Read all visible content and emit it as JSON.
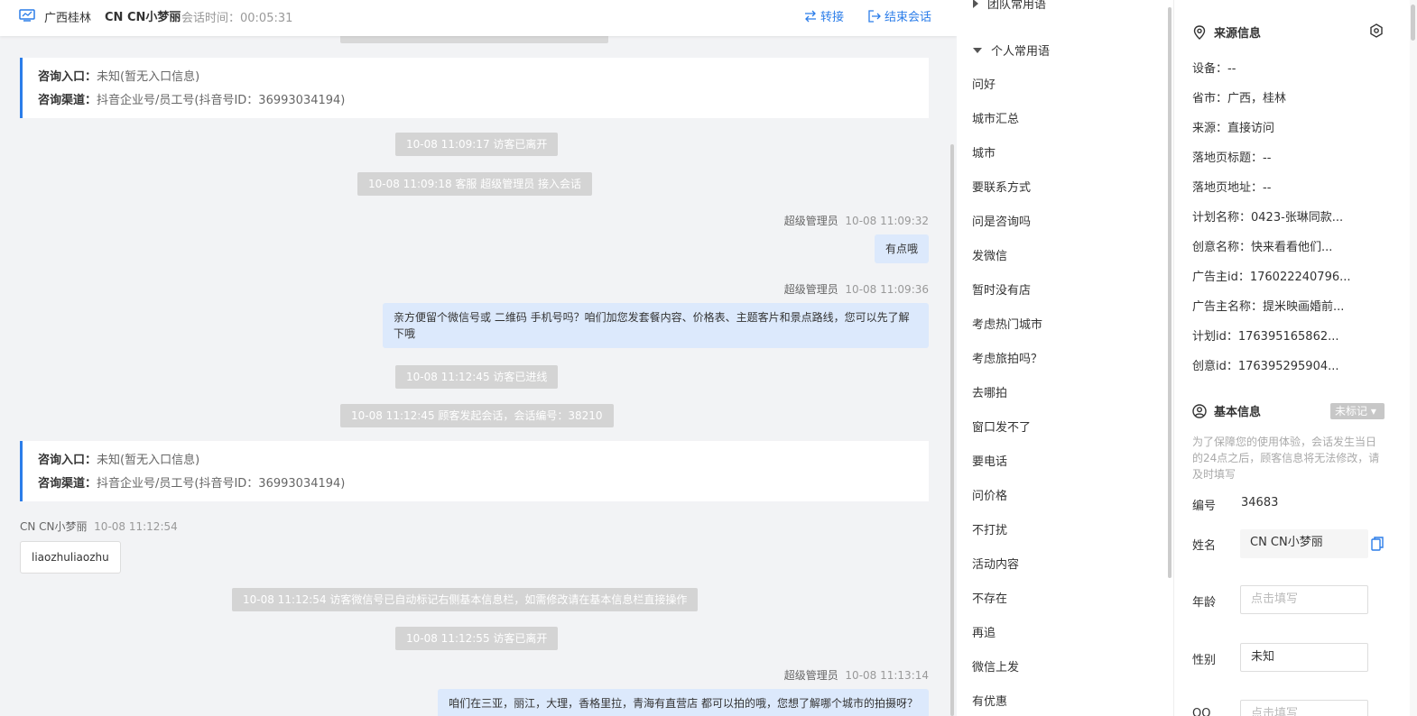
{
  "header": {
    "location": "广西桂林",
    "visitor_name": "CN CN小梦丽",
    "session_time": "会话时间：00:05:31",
    "transfer_label": "转接",
    "end_label": "结束会话"
  },
  "info_cards": [
    {
      "entry_label": "咨询入口：",
      "entry_value": "未知(暂无入口信息)",
      "channel_label": "咨询渠道：",
      "channel_value": "抖音企业号/员工号(抖音号ID：36993034194)"
    },
    {
      "entry_label": "咨询入口：",
      "entry_value": "未知(暂无入口信息)",
      "channel_label": "咨询渠道：",
      "channel_value": "抖音企业号/员工号(抖音号ID：36993034194)"
    }
  ],
  "system_messages": [
    "10-08 11:09:17 访客已离开",
    "10-08 11:09:18 客服 超级管理员 接入会话",
    "10-08 11:12:45 访客已进线",
    "10-08 11:12:45 顾客发起会话，会话编号：38210",
    "10-08 11:12:54 访客微信号已自动标记右侧基本信息栏，如需修改请在基本信息栏直接操作",
    "10-08 11:12:55 访客已离开"
  ],
  "messages": [
    {
      "sender": "超级管理员",
      "time": "10-08 11:09:32",
      "text": "有点哦"
    },
    {
      "sender": "超级管理员",
      "time": "10-08 11:09:36",
      "text": "亲方便留个微信号或 二维码 手机号吗？咱们加您发套餐内容、价格表、主题客片和景点路线，您可以先了解下哦"
    },
    {
      "sender": "CN CN小梦丽",
      "time": "10-08 11:12:54",
      "text": "liaozhuliaozhu"
    },
    {
      "sender": "超级管理员",
      "time": "10-08 11:13:14",
      "text": "咱们在三亚，丽江，大理，香格里拉，青海有直营店 都可以拍的哦，您想了解哪个城市的拍摄呀？"
    }
  ],
  "quick_replies": {
    "team_group": "团队常用语",
    "personal_group": "个人常用语",
    "items": [
      "问好",
      "城市汇总",
      "城市",
      "要联系方式",
      "问是咨询吗",
      "发微信",
      "暂时没有店",
      "考虑热门城市",
      "考虑旅拍吗？",
      "去哪拍",
      "窗口发不了",
      "要电话",
      "问价格",
      "不打扰",
      "活动内容",
      "不存在",
      "再追",
      "微信上发",
      "有优惠"
    ]
  },
  "source_info": {
    "title": "来源信息",
    "rows": [
      "设备：--",
      "省市：广西，桂林",
      "来源：直接访问",
      "落地页标题：--",
      "落地页地址：--",
      "计划名称：0423-张琳同款...",
      "创意名称：快来看看他们...",
      "广告主id：176022240796...",
      "广告主名称：提米映画婚前...",
      "计划id：176395165862...",
      "创意id：176395295904..."
    ]
  },
  "basic_info": {
    "title": "基本信息",
    "tag": "未标记",
    "note": "为了保障您的使用体验，会话发生当日的24点之后，顾客信息将无法修改，请及时填写",
    "id_label": "编号",
    "id_value": "34683",
    "name_label": "姓名",
    "name_value": "CN CN小梦丽",
    "age_label": "年龄",
    "age_placeholder": "点击填写",
    "gender_label": "性别",
    "gender_value": "未知",
    "qq_label": "QQ",
    "qq_placeholder": "点击填写"
  },
  "colors": {
    "accent": "#2b7de9",
    "bubble_self": "#dce9fc",
    "system_bg": "#d4d4d4"
  }
}
